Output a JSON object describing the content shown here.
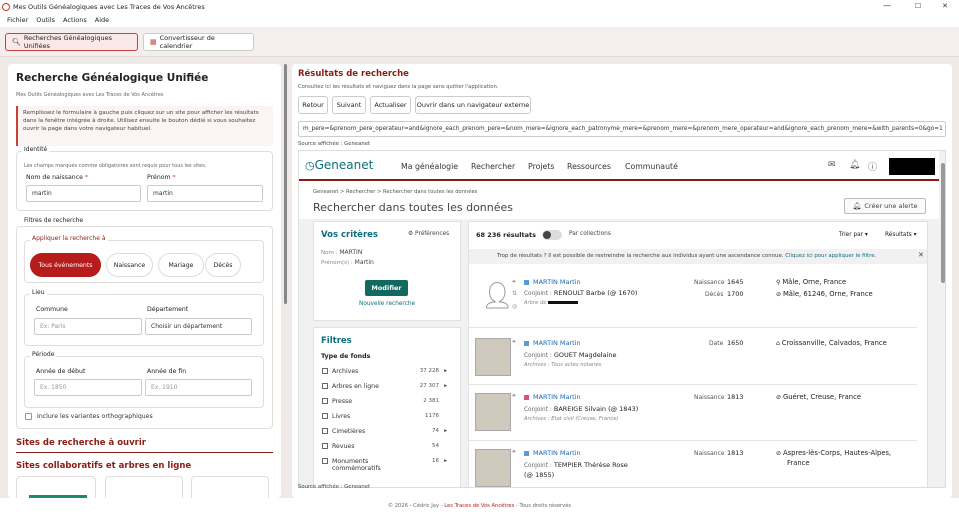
{
  "window": {
    "title": "Mes Outils Généalogiques avec Les Traces de Vos Ancêtres",
    "minimize": "—",
    "maximize": "☐",
    "close": "✕"
  },
  "menu": [
    "Fichier",
    "Outils",
    "Actions",
    "Aide"
  ],
  "toolbar": {
    "tab_search": "Recherches Généalogiques Unifiées",
    "tab_calendar": "Convertisseur de calendrier"
  },
  "left": {
    "title": "Recherche Généalogique Unifiée",
    "subtitle": "Mes Outils Généalogiques avec Les Traces de Vos Ancêtres",
    "info": "Remplissez le formulaire à gauche puis cliquez sur un site pour afficher les résultats dans la fenêtre intégrée à droite. Utilisez ensuite le bouton dédié si vous souhaitez ouvrir la page dans votre navigateur habituel.",
    "identity": {
      "legend": "Identité",
      "note": "Les champs marqués comme obligatoires sont requis pour tous les sites.",
      "surname_label": "Nom de naissance",
      "surname_value": "martin",
      "firstname_label": "Prénom",
      "firstname_value": "martin",
      "required_mark": "*"
    },
    "filters": {
      "legend": "Filtres de recherche",
      "apply_legend": "Appliquer la recherche à",
      "pills": [
        "Tous événements",
        "Naissance",
        "Mariage",
        "Décès"
      ],
      "place_legend": "Lieu",
      "commune_label": "Commune",
      "commune_placeholder": "Ex: Paris",
      "dept_label": "Département",
      "dept_value": "Choisir un département",
      "period_legend": "Période",
      "start_label": "Année de début",
      "start_placeholder": "Ex. 1850",
      "end_label": "Année de fin",
      "end_placeholder": "Ex. 1910",
      "variants_label": "Inclure les variantes orthographiques"
    },
    "section_sites": "Sites de recherche à ouvrir",
    "section_collab": "Sites collaboratifs et arbres en ligne"
  },
  "right": {
    "title": "Résultats de recherche",
    "subtitle": "Consultez ici les résultats et naviguez dans la page sans quitter l'application.",
    "buttons": [
      "Retour",
      "Suivant",
      "Actualiser",
      "Ouvrir dans un navigateur externe"
    ],
    "url": "m_pere=&prenom_pere_operateur=and&ignore_each_prenom_pere=&nom_mere=&ignore_each_patronyme_mere=&prenom_mere=&prenom_mere_operateur=and&ignore_each_prenom_mere=&with_parents=0&go=1",
    "source_label": "Source affichée : Geneanet"
  },
  "geneanet": {
    "logo": "Geneanet",
    "nav": [
      "Ma généalogie",
      "Rechercher",
      "Projets",
      "Ressources",
      "Communauté"
    ],
    "breadcrumb": "Geneanet > Rechercher > Rechercher dans toutes les données",
    "page_title": "Rechercher dans toutes les données",
    "alert_button": "Créer une alerte",
    "criteria": {
      "title": "Vos critères",
      "prefs": "Préférences",
      "nom_label": "Nom :",
      "nom": "MARTIN",
      "prenom_label": "Prénom(s) :",
      "prenom": "Martin",
      "modify": "Modifier",
      "new_search": "Nouvelle recherche"
    },
    "filters": {
      "title": "Filtres",
      "type_label": "Type de fonds",
      "items": [
        {
          "label": "Archives",
          "count": "37 228",
          "arrow": "▸"
        },
        {
          "label": "Arbres en ligne",
          "count": "27 307",
          "arrow": "▸"
        },
        {
          "label": "Presse",
          "count": "2 381",
          "arrow": ""
        },
        {
          "label": "Livres",
          "count": "1176",
          "arrow": ""
        },
        {
          "label": "Cimetières",
          "count": "74",
          "arrow": "▸"
        },
        {
          "label": "Revues",
          "count": "54",
          "arrow": ""
        },
        {
          "label": "Monuments commémoratifs",
          "count": "16",
          "arrow": "▸"
        }
      ]
    },
    "results_header": {
      "count": "68 236 résultats",
      "toggle_label": "Par collections",
      "sort": "Trier par",
      "results": "Résultats"
    },
    "notice": {
      "text": "Trop de résultats ? Il est possible de restreindre la recherche aux individus ayant une ascendance connue.",
      "link": "Cliquez ici pour appliquer le filtre."
    },
    "results": [
      {
        "name": "MARTIN Martin",
        "gender": "m",
        "line2_label": "Conjoint :",
        "line2": "RENOULT Barbe (@ 1670)",
        "small": "Arbre de",
        "ev1": "Naissance",
        "ev1_year": "1645",
        "ev1_place": "Mâle, Orne, France",
        "ev2": "Décès",
        "ev2_year": "1700",
        "ev2_place": "Mâle, 61246, Orne, France"
      },
      {
        "name": "MARTIN Martin",
        "gender": "m",
        "line2_label": "Conjoint :",
        "line2": "GOUET Magdelaine",
        "small": "Archives : Tous actes notariés",
        "ev1": "Date",
        "ev1_year": "1650",
        "ev1_place": "Croissanville, Calvados, France"
      },
      {
        "name": "MARTIN Martin",
        "gender": "f",
        "line2_label": "Conjoint :",
        "line2": "BAREIGE Silvain (@ 1843)",
        "small": "Archives : Etat civil (Creuse, France)",
        "ev1": "Naissance",
        "ev1_year": "1813",
        "ev1_place": "Guéret, Creuse, France"
      },
      {
        "name": "MARTIN Martin",
        "gender": "m",
        "line2_label": "Conjoint :",
        "line2": "TEMPIER Thérèse Rose",
        "line3": "(@ 1855)",
        "ev1": "Naissance",
        "ev1_year": "1813",
        "ev1_place": "Aspres-lès-Corps, Hautes-Alpes,",
        "ev1_place2": "France"
      }
    ]
  },
  "footer": {
    "prefix": "© 2026 - Cédric Jay -",
    "link": "Les Traces de Vos Ancêtres",
    "suffix": "- Tous droits réservés"
  }
}
